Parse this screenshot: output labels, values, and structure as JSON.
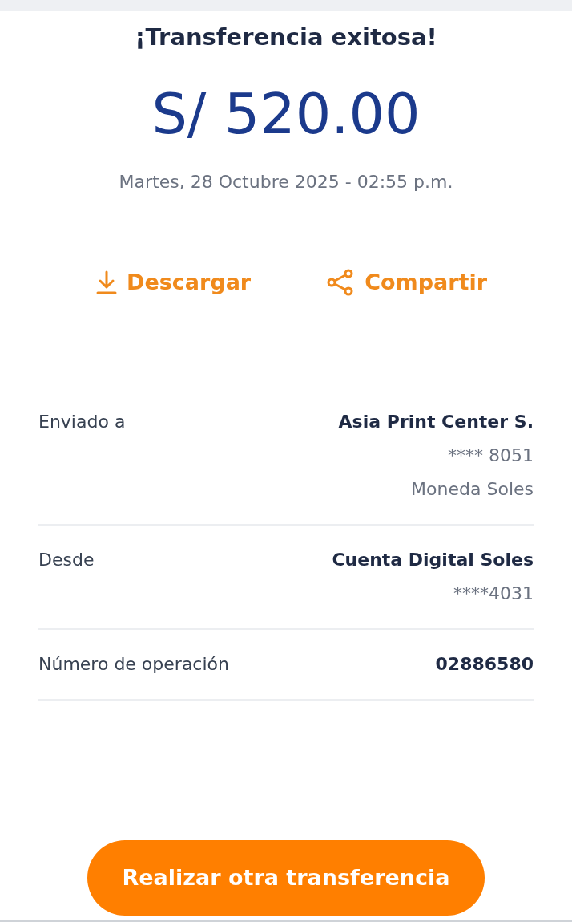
{
  "title": "¡Transferencia exitosa!",
  "amount": "S/ 520.00",
  "date": "Martes, 28 Octubre 2025 - 02:55 p.m.",
  "actions": [
    {
      "kind": "download",
      "label": "Descargar"
    },
    {
      "kind": "share",
      "label": "Compartir"
    }
  ],
  "details": [
    {
      "label": "Enviado a",
      "lines": [
        "Asia Print Center S.",
        "**** 8051",
        "Moneda Soles"
      ]
    },
    {
      "label": "Desde",
      "lines": [
        "Cuenta Digital Soles",
        "****4031"
      ]
    },
    {
      "label": "Número de operación",
      "lines": [
        "02886580"
      ]
    }
  ],
  "button": "Realizar otra transferencia"
}
